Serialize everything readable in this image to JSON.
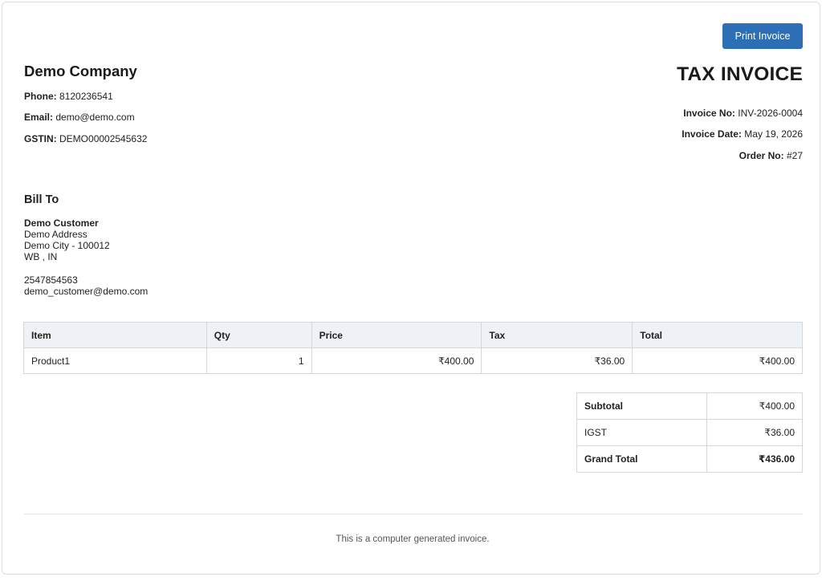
{
  "toolbar": {
    "print_label": "Print Invoice"
  },
  "company": {
    "name": "Demo Company",
    "phone_label": "Phone:",
    "phone": "8120236541",
    "email_label": "Email:",
    "email": "demo@demo.com",
    "gstin_label": "GSTIN:",
    "gstin": "DEMO00002545632"
  },
  "invoice": {
    "title": "TAX INVOICE",
    "number_label": "Invoice No:",
    "number": "INV-2026-0004",
    "date_label": "Invoice Date:",
    "date": "May 19, 2026",
    "order_label": "Order No:",
    "order": "#27"
  },
  "bill_to": {
    "heading": "Bill To",
    "name": "Demo Customer",
    "address": "Demo Address",
    "city": "Demo City - 100012",
    "region": "WB , IN",
    "phone": "2547854563",
    "email": "demo_customer@demo.com"
  },
  "items_table": {
    "headers": [
      "Item",
      "Qty",
      "Price",
      "Tax",
      "Total"
    ],
    "rows": [
      [
        "Product1",
        "1",
        "₹400.00",
        "₹36.00",
        "₹400.00"
      ]
    ]
  },
  "totals": {
    "subtotal_label": "Subtotal",
    "subtotal": "₹400.00",
    "igst_label": "IGST",
    "igst": "₹36.00",
    "grand_label": "Grand Total",
    "grand": "₹436.00"
  },
  "footer": {
    "note": "This is a computer generated invoice."
  },
  "colors": {
    "accent": "#2d6fb7",
    "table_header_bg": "#eef1f5",
    "border": "#d4d8dd"
  }
}
